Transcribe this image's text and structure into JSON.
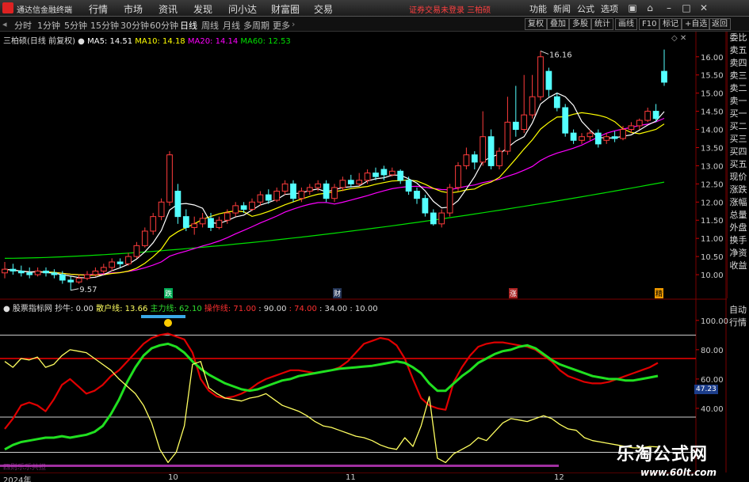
{
  "titlebar": {
    "app_name": "通达信金融终端",
    "menus": [
      "行情",
      "市场",
      "资讯",
      "发现",
      "问小达",
      "财富圈",
      "交易"
    ],
    "login_warning": "证券交易未登录 三柏硕",
    "right_menus": [
      "功能",
      "新闻",
      "公式",
      "选项"
    ]
  },
  "periodbar": {
    "periods": [
      "分时",
      "1分钟",
      "5分钟",
      "15分钟",
      "30分钟",
      "60分钟",
      "日线",
      "周线",
      "月线",
      "多周期",
      "更多"
    ],
    "active": "日线",
    "tools": [
      "复权",
      "叠加",
      "多股",
      "统计",
      "画线",
      "F10",
      "标记",
      "+自选",
      "返回"
    ]
  },
  "legend": {
    "stock": "三柏硕(日线 前复权)",
    "ma5": "MA5: 14.51",
    "ma10": "MA10: 14.18",
    "ma20": "MA20: 14.14",
    "ma60": "MA60: 12.53"
  },
  "indicator_legend": {
    "name": "股票指标网",
    "bottom": "抄牛: 0.00",
    "retail": "散户线: 13.66",
    "main": "主力线: 62.10",
    "op": "操作线: 71.00",
    "levels": ": 90.00",
    "l74": ": 74.00",
    "l34": ": 34.00",
    "l10": ": 10.00"
  },
  "right_tabs": [
    "委比",
    "卖五",
    "卖四",
    "卖三",
    "卖二",
    "卖一",
    "买一",
    "买二",
    "买三",
    "买四",
    "买五",
    "现价",
    "涨跌",
    "涨幅",
    "总量",
    "外盘",
    "换手",
    "净资",
    "收益"
  ],
  "right_tabs_lower": [
    "自动",
    "行情"
  ],
  "event_tags": {
    "t1": "跌",
    "t2": "财",
    "t3": "涨",
    "t4": "精"
  },
  "date_labels": [
    "2024年",
    "10",
    "11",
    "12"
  ],
  "bottom_note": "四则乐乐共担",
  "indicator_value_badge": "47.23",
  "watermark": {
    "title": "乐淘公式网",
    "url": "www.60lt.com"
  },
  "colors": {
    "up": "#ff3c3c",
    "down": "#54ffff",
    "ma5": "#ffffff",
    "ma10": "#ffff00",
    "ma20": "#ff00ff",
    "ma60": "#00e000"
  },
  "chart_data": [
    {
      "type": "candlestick",
      "title": "三柏硕(日线 前复权)",
      "ylim": [
        9.5,
        16.3
      ],
      "yticks": [
        10.0,
        10.5,
        11.0,
        11.5,
        12.0,
        12.5,
        13.0,
        13.5,
        14.0,
        14.5,
        15.0,
        15.5,
        16.0
      ],
      "annotations": [
        {
          "label": "16.16",
          "value": 16.16
        },
        {
          "label": "9.57",
          "value": 9.57
        }
      ],
      "candles": [
        [
          10.05,
          10.15,
          10.35,
          9.9
        ],
        [
          10.15,
          10.1,
          10.3,
          10.0
        ],
        [
          10.1,
          10.05,
          10.25,
          9.95
        ],
        [
          10.05,
          10.0,
          10.2,
          9.9
        ],
        [
          10.0,
          10.1,
          10.2,
          9.95
        ],
        [
          10.1,
          10.05,
          10.2,
          9.95
        ],
        [
          10.05,
          10.0,
          10.15,
          9.9
        ],
        [
          10.0,
          9.85,
          10.1,
          9.75
        ],
        [
          9.85,
          9.8,
          9.95,
          9.57
        ],
        [
          9.8,
          9.9,
          10.0,
          9.75
        ],
        [
          9.9,
          10.0,
          10.1,
          9.85
        ],
        [
          10.0,
          10.1,
          10.2,
          9.95
        ],
        [
          10.1,
          10.2,
          10.3,
          10.0
        ],
        [
          10.2,
          10.35,
          10.45,
          10.1
        ],
        [
          10.35,
          10.3,
          10.45,
          10.2
        ],
        [
          10.3,
          10.5,
          10.6,
          10.25
        ],
        [
          10.5,
          10.8,
          10.9,
          10.45
        ],
        [
          10.8,
          11.2,
          11.3,
          10.75
        ],
        [
          11.2,
          11.6,
          11.7,
          11.1
        ],
        [
          11.6,
          12.0,
          12.1,
          11.5
        ],
        [
          12.0,
          13.3,
          13.4,
          11.9
        ],
        [
          12.3,
          11.6,
          12.5,
          11.4
        ],
        [
          11.6,
          11.3,
          11.8,
          11.2
        ],
        [
          11.3,
          11.4,
          11.6,
          11.1
        ],
        [
          11.4,
          11.55,
          11.7,
          11.3
        ],
        [
          11.55,
          11.3,
          11.7,
          11.2
        ],
        [
          11.3,
          11.5,
          11.6,
          11.25
        ],
        [
          11.5,
          11.7,
          11.8,
          11.4
        ],
        [
          11.7,
          11.9,
          12.0,
          11.6
        ],
        [
          11.9,
          11.8,
          12.0,
          11.7
        ],
        [
          11.8,
          12.0,
          12.1,
          11.75
        ],
        [
          12.0,
          12.2,
          12.3,
          11.9
        ],
        [
          12.2,
          12.05,
          12.35,
          11.95
        ],
        [
          12.05,
          12.3,
          12.4,
          12.0
        ],
        [
          12.3,
          12.5,
          12.6,
          12.2
        ],
        [
          12.5,
          12.1,
          12.6,
          12.0
        ],
        [
          12.1,
          12.3,
          12.4,
          12.0
        ],
        [
          12.3,
          12.4,
          12.5,
          12.2
        ],
        [
          12.4,
          12.5,
          12.6,
          12.3
        ],
        [
          12.5,
          12.1,
          12.6,
          12.0
        ],
        [
          12.1,
          12.4,
          12.5,
          12.0
        ],
        [
          12.4,
          12.6,
          12.7,
          12.3
        ],
        [
          12.6,
          12.5,
          12.75,
          12.4
        ],
        [
          12.5,
          12.6,
          12.8,
          12.45
        ],
        [
          12.6,
          12.8,
          12.9,
          12.5
        ],
        [
          12.8,
          12.7,
          12.95,
          12.6
        ],
        [
          12.9,
          12.75,
          13.0,
          12.6
        ],
        [
          12.75,
          12.85,
          12.95,
          12.7
        ],
        [
          12.85,
          12.6,
          12.9,
          12.5
        ],
        [
          12.6,
          12.3,
          12.7,
          12.2
        ],
        [
          12.3,
          12.1,
          12.4,
          11.95
        ],
        [
          12.1,
          11.7,
          12.2,
          11.6
        ],
        [
          11.7,
          11.4,
          11.8,
          11.35
        ],
        [
          11.4,
          11.7,
          11.8,
          11.3
        ],
        [
          11.7,
          12.4,
          12.5,
          11.6
        ],
        [
          12.4,
          13.0,
          13.1,
          12.3
        ],
        [
          13.0,
          13.3,
          13.5,
          12.9
        ],
        [
          13.3,
          13.1,
          13.4,
          12.9
        ],
        [
          13.1,
          13.8,
          14.5,
          13.0
        ],
        [
          13.8,
          13.0,
          14.0,
          12.9
        ],
        [
          13.0,
          13.4,
          13.5,
          12.9
        ],
        [
          13.4,
          14.2,
          14.9,
          13.3
        ],
        [
          14.2,
          14.0,
          15.2,
          13.8
        ],
        [
          14.0,
          14.4,
          15.5,
          13.9
        ],
        [
          14.4,
          14.9,
          15.5,
          14.3
        ],
        [
          14.9,
          16.0,
          16.16,
          14.8
        ],
        [
          15.6,
          15.1,
          15.7,
          14.9
        ],
        [
          14.9,
          14.6,
          15.0,
          14.5
        ],
        [
          14.6,
          13.9,
          14.7,
          13.8
        ],
        [
          13.9,
          13.7,
          14.0,
          13.6
        ],
        [
          13.7,
          13.8,
          13.9,
          13.6
        ],
        [
          13.8,
          13.9,
          14.0,
          13.7
        ],
        [
          13.9,
          13.6,
          14.0,
          13.5
        ],
        [
          13.7,
          13.8,
          13.9,
          13.6
        ],
        [
          13.8,
          13.75,
          13.95,
          13.65
        ],
        [
          13.75,
          14.0,
          14.1,
          13.7
        ],
        [
          14.0,
          14.1,
          14.2,
          13.9
        ],
        [
          14.1,
          14.25,
          14.3,
          14.0
        ],
        [
          14.25,
          14.5,
          14.6,
          14.2
        ],
        [
          14.5,
          14.3,
          14.7,
          14.2
        ],
        [
          15.6,
          15.3,
          16.2,
          15.2
        ]
      ]
    },
    {
      "type": "line",
      "title": "股票指标网",
      "ylim": [
        0,
        108
      ],
      "yticks": [
        40,
        60,
        80,
        100
      ],
      "hlines": [
        90,
        74,
        34,
        10
      ],
      "series": [
        {
          "name": "散户线",
          "values": [
            72,
            68,
            74,
            73,
            75,
            68,
            70,
            76,
            80,
            79,
            78,
            74,
            70,
            66,
            60,
            55,
            50,
            42,
            30,
            12,
            3,
            10,
            28,
            70,
            72,
            54,
            50,
            47,
            46,
            45,
            47,
            48,
            50,
            46,
            42,
            40,
            38,
            35,
            31,
            28,
            27,
            25,
            23,
            21,
            20,
            18,
            15,
            13,
            12,
            20,
            14,
            28,
            48,
            6,
            3,
            9,
            12,
            15,
            20,
            18,
            24,
            30,
            33,
            32,
            31,
            33,
            35,
            33,
            29,
            26,
            25,
            20,
            18,
            17,
            16,
            15,
            14,
            13,
            13,
            14,
            13.66
          ]
        },
        {
          "name": "主力线",
          "values": [
            12,
            15,
            17,
            18,
            19,
            20,
            20,
            21,
            20,
            21,
            22,
            24,
            28,
            36,
            46,
            58,
            68,
            76,
            81,
            83,
            84,
            82,
            78,
            72,
            67,
            63,
            60,
            57,
            55,
            53,
            52,
            53,
            55,
            57,
            59,
            60,
            62,
            63,
            64,
            65,
            66,
            67,
            67.5,
            68,
            68.5,
            69,
            70,
            71,
            72,
            71,
            68,
            64,
            57,
            52,
            52,
            57,
            62,
            66,
            71,
            74,
            77,
            79,
            80,
            82,
            83,
            81,
            77,
            73,
            70,
            68,
            66,
            64,
            62,
            61,
            60,
            60,
            59,
            59,
            60,
            61,
            62.1
          ]
        },
        {
          "name": "操作线",
          "values": [
            26,
            33,
            42,
            44,
            42,
            38,
            46,
            56,
            60,
            55,
            50,
            52,
            56,
            62,
            66,
            72,
            78,
            84,
            88,
            90,
            91,
            89,
            87,
            78,
            60,
            52,
            48,
            47,
            48,
            50,
            53,
            57,
            60,
            62,
            64,
            66,
            66,
            65,
            64,
            65,
            66,
            68,
            72,
            78,
            84,
            86,
            88,
            87,
            83,
            74,
            60,
            47,
            42,
            40,
            39,
            58,
            68,
            76,
            82,
            84,
            85,
            85,
            84,
            83,
            82,
            80,
            76,
            72,
            66,
            62,
            60,
            58,
            57,
            57,
            58,
            60,
            62,
            64,
            66,
            68,
            71
          ]
        }
      ]
    }
  ]
}
